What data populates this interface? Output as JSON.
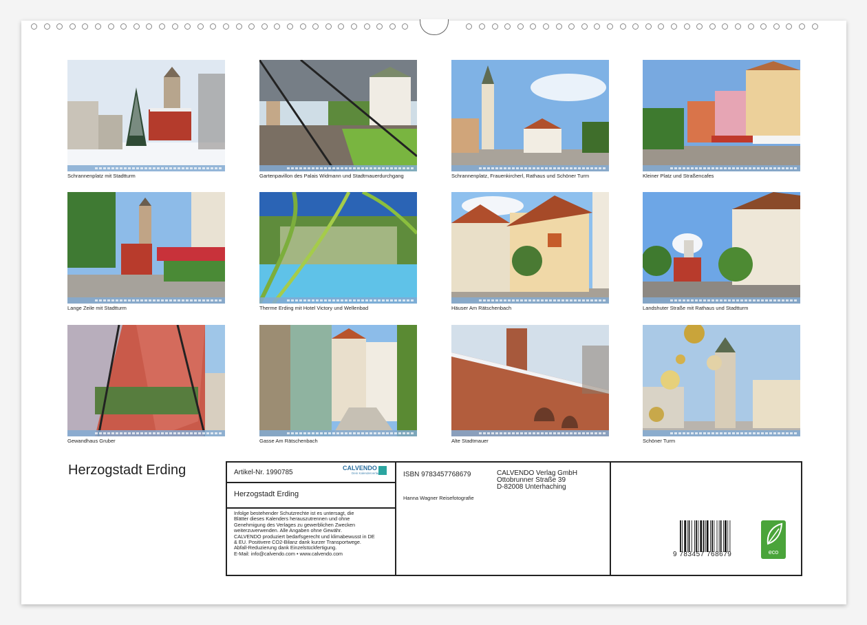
{
  "calendar_title": "Herzogstadt Erding",
  "photos": [
    {
      "caption": "Schrannenplatz mit Stadtturm",
      "scene": "winter-tower"
    },
    {
      "caption": "Gartenpavillon des Palais Widmann und Stadtmauerdurchgang",
      "scene": "pavilion"
    },
    {
      "caption": "Schrannenplatz, Frauenkircherl, Rathaus und Schöner Turm",
      "scene": "square-summer"
    },
    {
      "caption": "Kleiner Platz und Straßencafes",
      "scene": "cafes"
    },
    {
      "caption": "Lange Zeile mit Stadtturm",
      "scene": "street-tower"
    },
    {
      "caption": "Therme Erding mit Hotel Victory und Wellenbad",
      "scene": "therme"
    },
    {
      "caption": "Häuser Am Rätschenbach",
      "scene": "houses"
    },
    {
      "caption": "Landshuter Straße mit Rathaus und Stadtturm",
      "scene": "landshuter"
    },
    {
      "caption": "Gewandhaus Gruber",
      "scene": "reflection"
    },
    {
      "caption": "Gasse Am Rätschenbach",
      "scene": "alley"
    },
    {
      "caption": "Alte Stadtmauer",
      "scene": "wall"
    },
    {
      "caption": "Schöner Turm",
      "scene": "christmas"
    }
  ],
  "info": {
    "article": "Artikel-Nr. 1990785",
    "brand": "CALVENDO",
    "brand_tagline": "Dein Kalenderverlag",
    "title": "Herzogstadt Erding",
    "legal": [
      "Infolge bestehender Schutzrechte ist es untersagt, die",
      "Blätter dieses Kalenders herauszutrennen und ohne",
      "Genehmigung des Verlages zu gewerblichen Zwecken",
      "weiterzuverwenden. Alle Angaben ohne Gewähr.",
      "CALVENDO produziert bedarfsgerecht und klimabewusst in DE",
      "& EU. Positivere CO2-Bilanz dank kurzer Transportwege.",
      "Abfall-Reduzierung dank Einzelstückfertigung.",
      "E-Mail: info@calvendo.com • www.calvendo.com"
    ],
    "isbn": "ISBN 9783457768679",
    "author": "Hanna Wagner Reisefotografie",
    "publisher": [
      "CALVENDO Verlag GmbH",
      "Ottobrunner Straße 39",
      "D-82008 Unterhaching"
    ],
    "barcode_number": "9 783457 768679",
    "eco_label": "eco"
  },
  "colors": {
    "accent_green": "#4aa43a",
    "strip_blue": "#82aad2"
  }
}
